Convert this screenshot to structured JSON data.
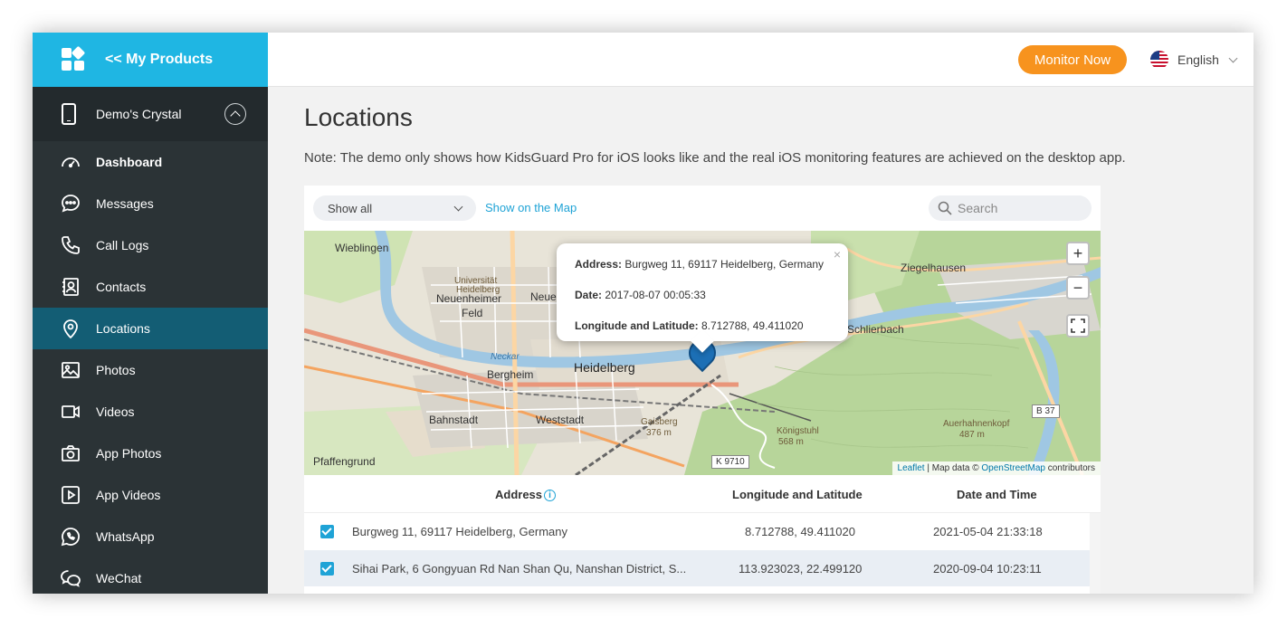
{
  "brand": {
    "label": "<< My Products",
    "icon": "apps-icon"
  },
  "device": {
    "name": "Demo's Crystal"
  },
  "nav": [
    {
      "label": "Dashboard",
      "icon": "dashboard-icon"
    },
    {
      "label": "Messages",
      "icon": "message-icon"
    },
    {
      "label": "Call Logs",
      "icon": "phone-icon"
    },
    {
      "label": "Contacts",
      "icon": "contacts-icon"
    },
    {
      "label": "Locations",
      "icon": "location-pin-icon",
      "active": true
    },
    {
      "label": "Photos",
      "icon": "photo-icon"
    },
    {
      "label": "Videos",
      "icon": "video-icon"
    },
    {
      "label": "App Photos",
      "icon": "camera-icon"
    },
    {
      "label": "App Videos",
      "icon": "play-icon"
    },
    {
      "label": "WhatsApp",
      "icon": "whatsapp-icon"
    },
    {
      "label": "WeChat",
      "icon": "wechat-icon"
    }
  ],
  "topbar": {
    "monitor_label": "Monitor Now",
    "language": "English"
  },
  "page": {
    "title": "Locations",
    "note": "Note: The demo only shows how KidsGuard Pro for iOS looks like and the real iOS monitoring features are achieved on the desktop app."
  },
  "toolbar": {
    "filter_value": "Show all",
    "show_map_label": "Show on the Map",
    "search_placeholder": "Search"
  },
  "map": {
    "labels": {
      "wieblingen": "Wieblingen",
      "ziegelhausen": "Ziegelhausen",
      "universitat": "Universität",
      "heidelberg_small": "Heidelberg",
      "neuenheimer": "Neuenheimer",
      "feld": "Feld",
      "neue": "Neue",
      "schlierbach": "Schlierbach",
      "bergheim": "Bergheim",
      "heidelberg": "Heidelberg",
      "bahnstadt": "Bahnstadt",
      "weststadt": "Weststadt",
      "pfaffengrund": "Pfaffengrund",
      "gaisberg": "Gaisberg",
      "gaisberg_elev": "376 m",
      "konigstuhl": "Königstuhl",
      "konigstuhl_elev": "568 m",
      "auerhahnenkopf": "Auerhahnenkopf",
      "auerhahnenkopf_elev": "487 m",
      "road_k9710": "K 9710",
      "road_b37": "B 37",
      "neckar": "Neckar"
    },
    "popup": {
      "address_label": "Address:",
      "address": "Burgweg 11, 69117 Heidelberg, Germany",
      "date_label": "Date:",
      "date": "2017-08-07 00:05:33",
      "lonlat_label": "Longitude and Latitude:",
      "lonlat": "8.712788, 49.411020"
    },
    "attribution": {
      "leaflet": "Leaflet",
      "text": " | Map data © ",
      "osm": "OpenStreetMap",
      "suffix": " contributors"
    }
  },
  "table": {
    "headers": {
      "address": "Address",
      "lonlat": "Longitude and Latitude",
      "datetime": "Date and Time"
    },
    "rows": [
      {
        "address": "Burgweg 11, 69117 Heidelberg, Germany",
        "lonlat": "8.712788, 49.411020",
        "datetime": "2021-05-04 21:33:18",
        "checked": true
      },
      {
        "address": "Sihai Park, 6 Gongyuan Rd Nan Shan Qu, Nanshan District, S...",
        "lonlat": "113.923023, 22.499120",
        "datetime": "2020-09-04 10:23:11",
        "checked": true
      }
    ]
  },
  "colors": {
    "accent": "#1fb6e3",
    "sidebar": "#2b3336",
    "active_nav": "#135d74",
    "cta": "#f7931e",
    "link": "#1fa3d6"
  }
}
